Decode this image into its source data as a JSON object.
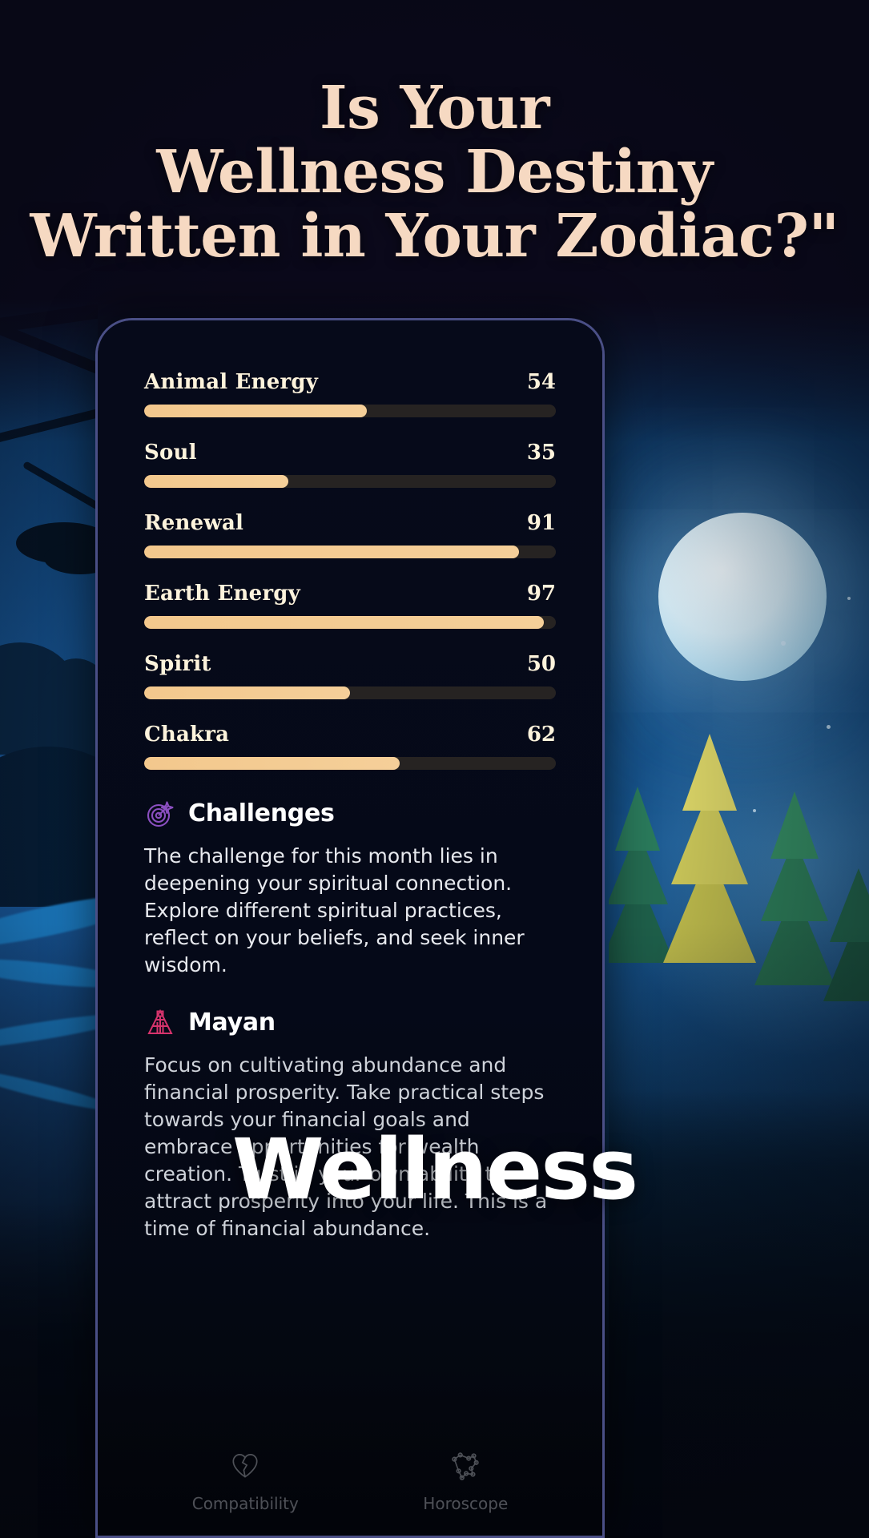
{
  "headline": {
    "line1": "Is Your",
    "line2": "Wellness Destiny",
    "line3": "Written in Your Zodiac?\""
  },
  "overlay": {
    "word": "Wellness"
  },
  "colors": {
    "headline_text": "#f6d9c2",
    "bar_fill": "#f3c88d",
    "bar_track": "#262322",
    "stat_label": "#fdf3dc",
    "challenges_icon": "#8b4fc0",
    "mayan_icon": "#d6336c",
    "phone_border": "#4a4f86",
    "phone_bg": "#060b1c",
    "moon": "#d8eef8"
  },
  "chart_data": {
    "type": "bar",
    "title": "",
    "xlabel": "",
    "ylabel": "",
    "ylim": [
      0,
      100
    ],
    "grid": false,
    "legend": "none",
    "orientation": "horizontal",
    "categories": [
      "Animal Energy",
      "Soul",
      "Renewal",
      "Earth Energy",
      "Spirit",
      "Chakra"
    ],
    "values": [
      54,
      35,
      91,
      97,
      50,
      62
    ]
  },
  "phone": {
    "stats": [
      {
        "label": "Animal Energy",
        "value": "54",
        "pct": 54
      },
      {
        "label": "Soul",
        "value": "35",
        "pct": 35
      },
      {
        "label": "Renewal",
        "value": "91",
        "pct": 91
      },
      {
        "label": "Earth Energy",
        "value": "97",
        "pct": 97
      },
      {
        "label": "Spirit",
        "value": "50",
        "pct": 50
      },
      {
        "label": "Chakra",
        "value": "62",
        "pct": 62
      }
    ],
    "challenges": {
      "icon": "target-dart-icon",
      "title": "Challenges",
      "body": "The challenge for this month lies in deepening your spiritual connection. Explore different spiritual practices, reflect on your beliefs, and seek inner wisdom."
    },
    "mayan": {
      "icon": "pyramid-icon",
      "title": "Mayan",
      "body": "Focus on cultivating abundance and financial prosperity. Take practical steps towards your financial goals and embrace opportunities for wealth creation. Trust in your own ability to attract prosperity into your life. This is a time of financial abundance."
    },
    "nav": [
      {
        "icon": "heart-broken-icon",
        "label": "Compatibility"
      },
      {
        "icon": "constellation-icon",
        "label": "Horoscope"
      }
    ]
  }
}
